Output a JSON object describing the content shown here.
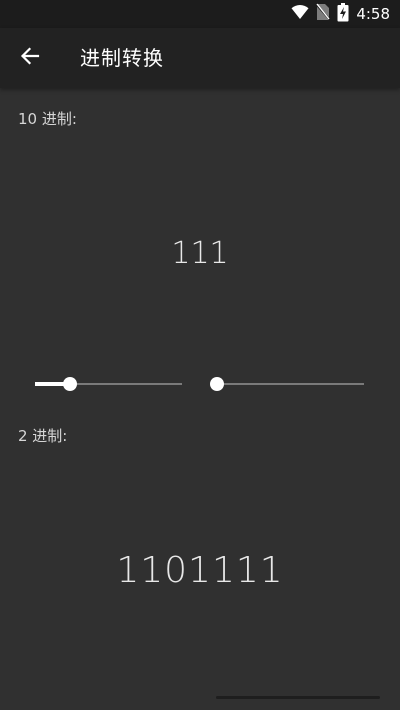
{
  "status_bar": {
    "time": "4:58",
    "icons": [
      "wifi-icon",
      "no-sim-icon",
      "battery-charging-icon"
    ]
  },
  "app_bar": {
    "back_icon": "arrow-back-icon",
    "title": "进制转换"
  },
  "decimal_section": {
    "label": "10 进制:",
    "value": "111"
  },
  "sliders": [
    {
      "name": "decimal-slider",
      "value_fraction": 0.24
    },
    {
      "name": "binary-slider",
      "value_fraction": 0.0
    }
  ],
  "binary_section": {
    "label": "2 进制:",
    "value": "1101111"
  },
  "colors": {
    "background": "#303030",
    "app_bar": "#222222",
    "status_bar": "#1c1c1c",
    "text_primary": "#e8e8e8",
    "slider_track": "#7a7a7a",
    "slider_active": "#ffffff"
  }
}
